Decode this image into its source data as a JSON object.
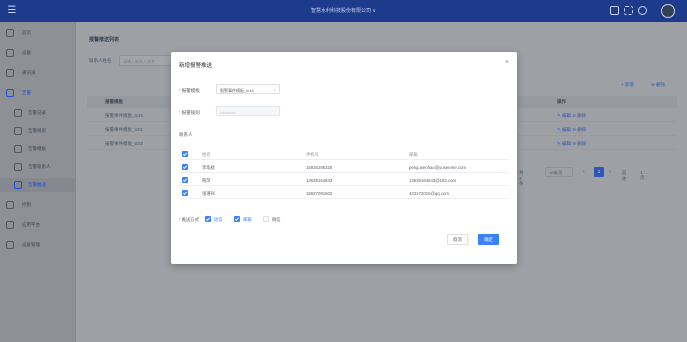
{
  "topbar": {
    "menu_icon": "menu-toggle-icon",
    "company": "智慧水利科技股份有限公司 ∨",
    "icons": [
      "screen-icon",
      "fullscreen-icon",
      "help-icon"
    ],
    "avatar": "user-avatar"
  },
  "sidebar": {
    "items": [
      {
        "label": "首页",
        "icon": "home-icon"
      },
      {
        "label": "设备",
        "icon": "device-icon"
      },
      {
        "label": "通讯录",
        "icon": "contacts-icon"
      },
      {
        "label": "告警",
        "icon": "alarm-icon"
      },
      {
        "label": "告警记录",
        "icon": "record-icon"
      },
      {
        "label": "告警规则",
        "icon": "rule-icon"
      },
      {
        "label": "告警模板",
        "icon": "template-icon"
      },
      {
        "label": "告警联系人",
        "icon": "contact-icon"
      },
      {
        "label": "告警推送",
        "icon": "push-icon"
      },
      {
        "label": "控制",
        "icon": "control-icon"
      },
      {
        "label": "应用平台",
        "icon": "platform-icon"
      },
      {
        "label": "设备管理",
        "icon": "manage-icon"
      }
    ]
  },
  "main": {
    "title": "报警推送列表",
    "filter_label": "联系人姓名",
    "filter_placeholder": "请输入联系人姓名",
    "add_link": "+ 新增",
    "delete_link": "⊖ 删除",
    "columns": {
      "name": "报警模板",
      "ops": "操作"
    },
    "rows": [
      {
        "name": "报警事件模板_tc16",
        "ops": "✎ 编辑  ⊖ 删除"
      },
      {
        "name": "报警事件模板_tc01",
        "ops": "✎ 编辑  ⊖ 删除"
      },
      {
        "name": "报警事件模板_tc03",
        "ops": "✎ 编辑  ⊖ 删除"
      }
    ],
    "pager": {
      "total": "共 3 条",
      "size": "10条/页",
      "prev": "‹",
      "page": "1",
      "next": "›",
      "goto": "前往",
      "goto_val": "1 页"
    }
  },
  "modal": {
    "title": "新增报警推送",
    "close": "×",
    "template_label": "报警模板",
    "template_value": "报警事件模板_tc16",
    "template_caret": "∨",
    "rule_label": "报警规则",
    "rule_value": "weihanxi",
    "contacts_label": "联系人",
    "table_headers": {
      "name": "姓名",
      "phone": "手机号",
      "email": "邮箱"
    },
    "contacts": [
      {
        "name": "李焰枕",
        "phone": "15926295325",
        "email": "peng.wenhao@yoseeme.com"
      },
      {
        "name": "韩萍",
        "phone": "13639164843",
        "email": "13639164843@163.com"
      },
      {
        "name": "张瑾祥",
        "phone": "15927091502",
        "email": "423172016@qq.com"
      }
    ],
    "method_label": "推送方式",
    "methods": [
      {
        "label": "短信",
        "checked": true
      },
      {
        "label": "邮箱",
        "checked": true
      },
      {
        "label": "微信",
        "checked": false
      }
    ],
    "cancel": "取消",
    "confirm": "确定"
  },
  "colors": {
    "primary": "#3b82f6",
    "header": "#1e3a8a",
    "overlay": "#9ea0a6"
  }
}
